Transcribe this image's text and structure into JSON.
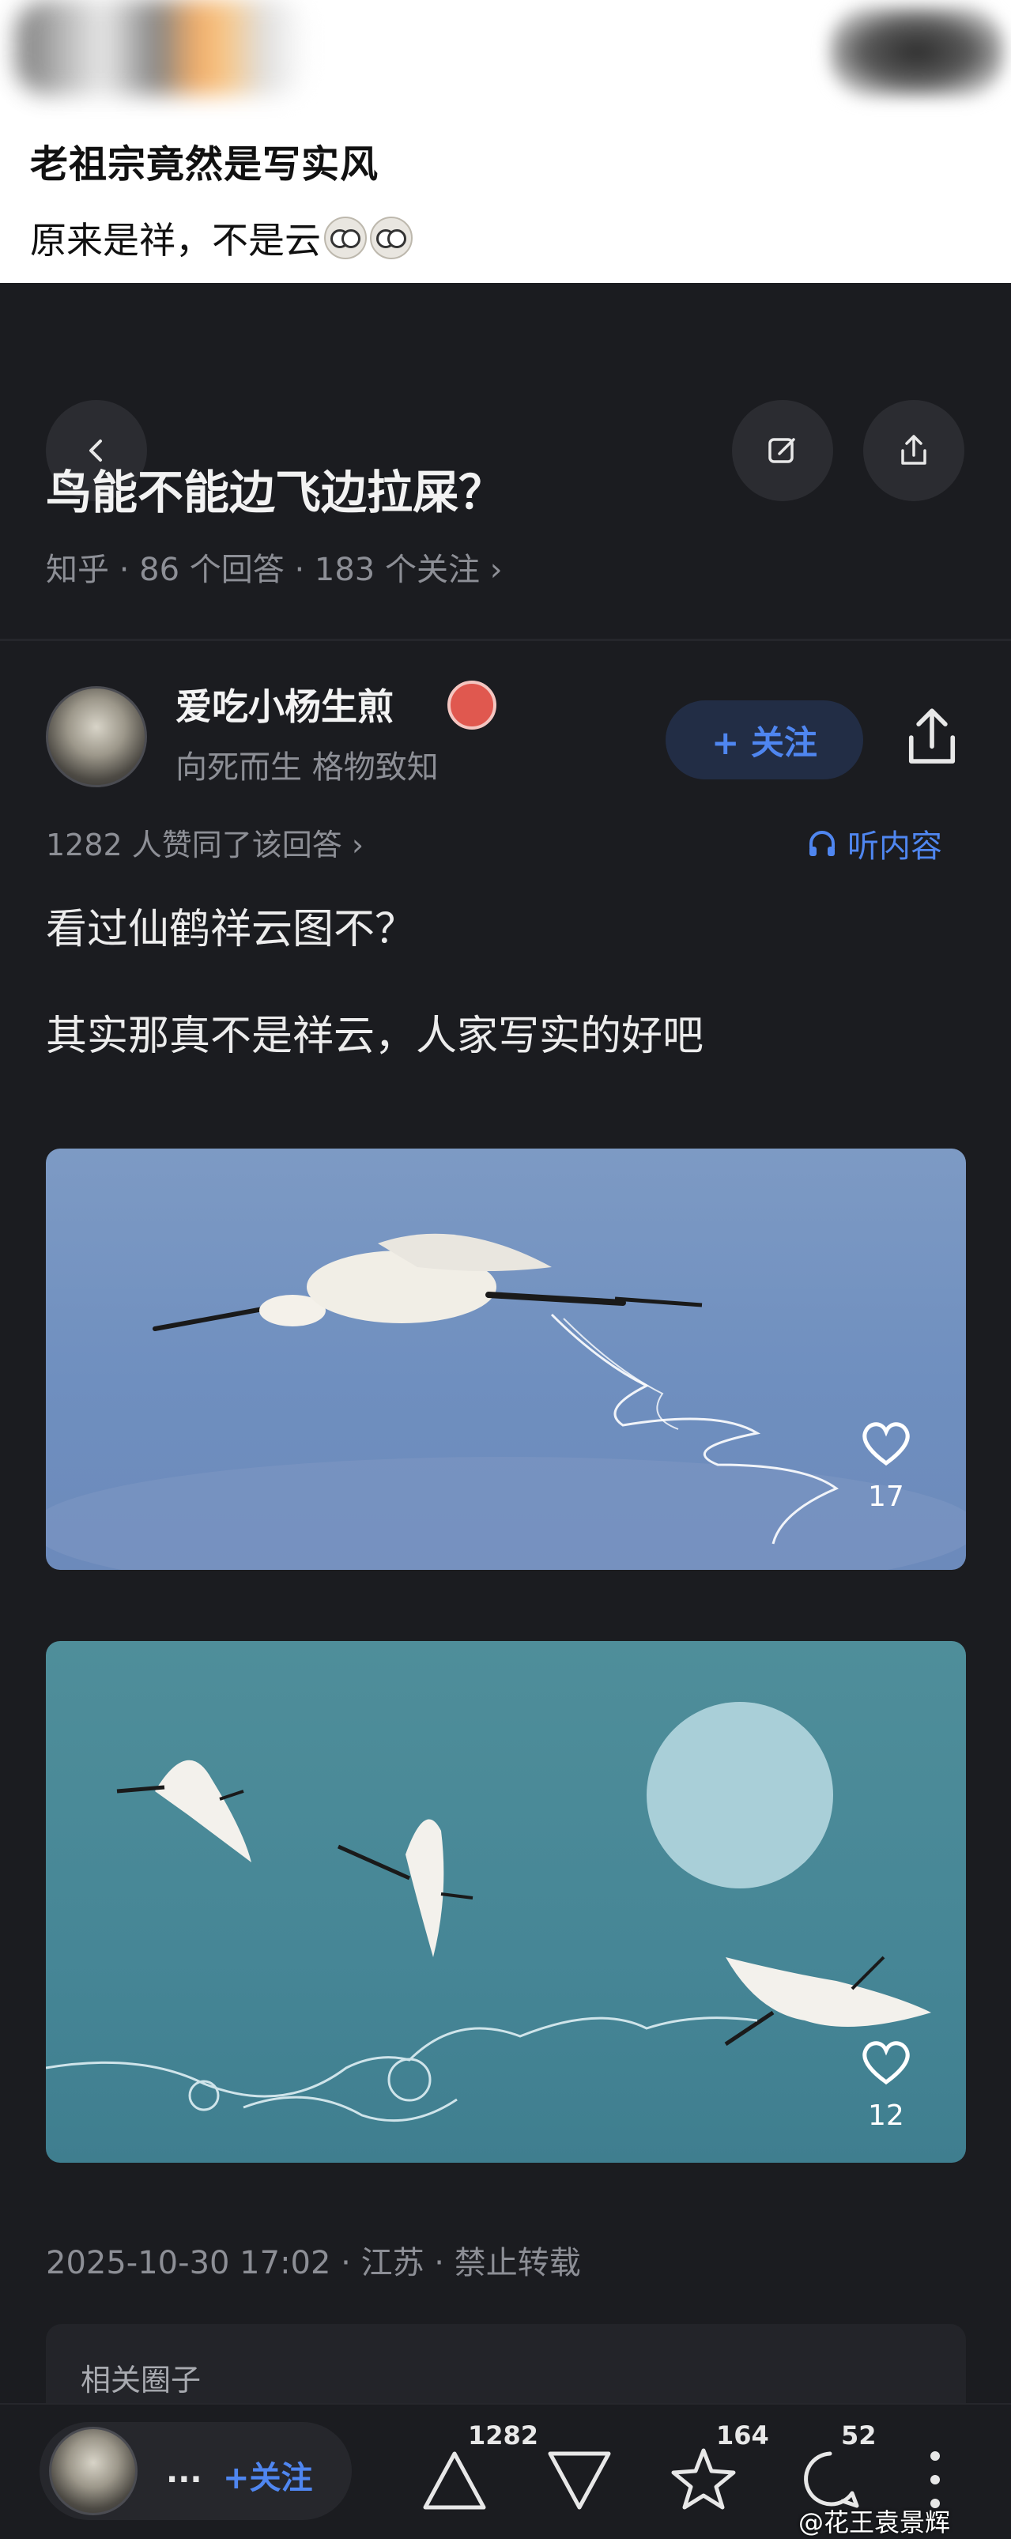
{
  "weibo": {
    "title": "老祖宗竟然是写实风",
    "subtitle": "原来是祥，不是云"
  },
  "zhihu": {
    "question_title": "鸟能不能边飞边拉屎？",
    "question_meta": "知乎 · 86 个回答 · 183 个关注 ›",
    "author": {
      "name": "爱吃小杨生煎",
      "signature": "向死而生  格物致知",
      "follow_label": "+ 关注"
    },
    "agree_text": "1282 人赞同了该回答 ›",
    "listen_label": "听内容",
    "paragraphs": [
      "看过仙鹤祥云图不？",
      "其实那真不是祥云，人家写实的好吧"
    ],
    "images": [
      {
        "likes": "17"
      },
      {
        "likes": "12"
      }
    ],
    "post_meta": "2025-10-30 17:02 · 江苏 · 禁止转载",
    "related_label": "相关圈子",
    "bottom_bar": {
      "author_abbrev": "...",
      "follow_label": "+关注",
      "upvotes": "1282",
      "favorites": "164",
      "comments": "52"
    }
  },
  "watermark": "@花王袁景辉",
  "colors": {
    "zhihu_bg": "#1b1c20",
    "accent_blue": "#4f86f0",
    "text_muted": "#8d8f96"
  }
}
